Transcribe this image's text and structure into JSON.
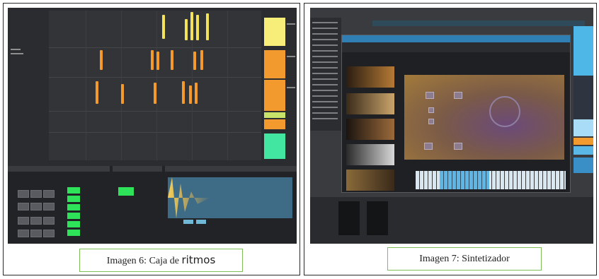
{
  "figures": [
    {
      "caption_prefix": "Imagen 6: Caja de ",
      "caption_emphasis": "ritmos",
      "image_description_icon": "drum-rack-screenshot"
    },
    {
      "caption": "Imagen 7: Sintetizador",
      "image_description_icon": "synthesizer-screenshot"
    }
  ],
  "colors": {
    "caption_border": "#7fbf5a",
    "clip_yellow": "#f3e35a",
    "clip_orange": "#f29a2e",
    "pad_green": "#2ee35a",
    "synth_blue": "#2f7fb4"
  }
}
